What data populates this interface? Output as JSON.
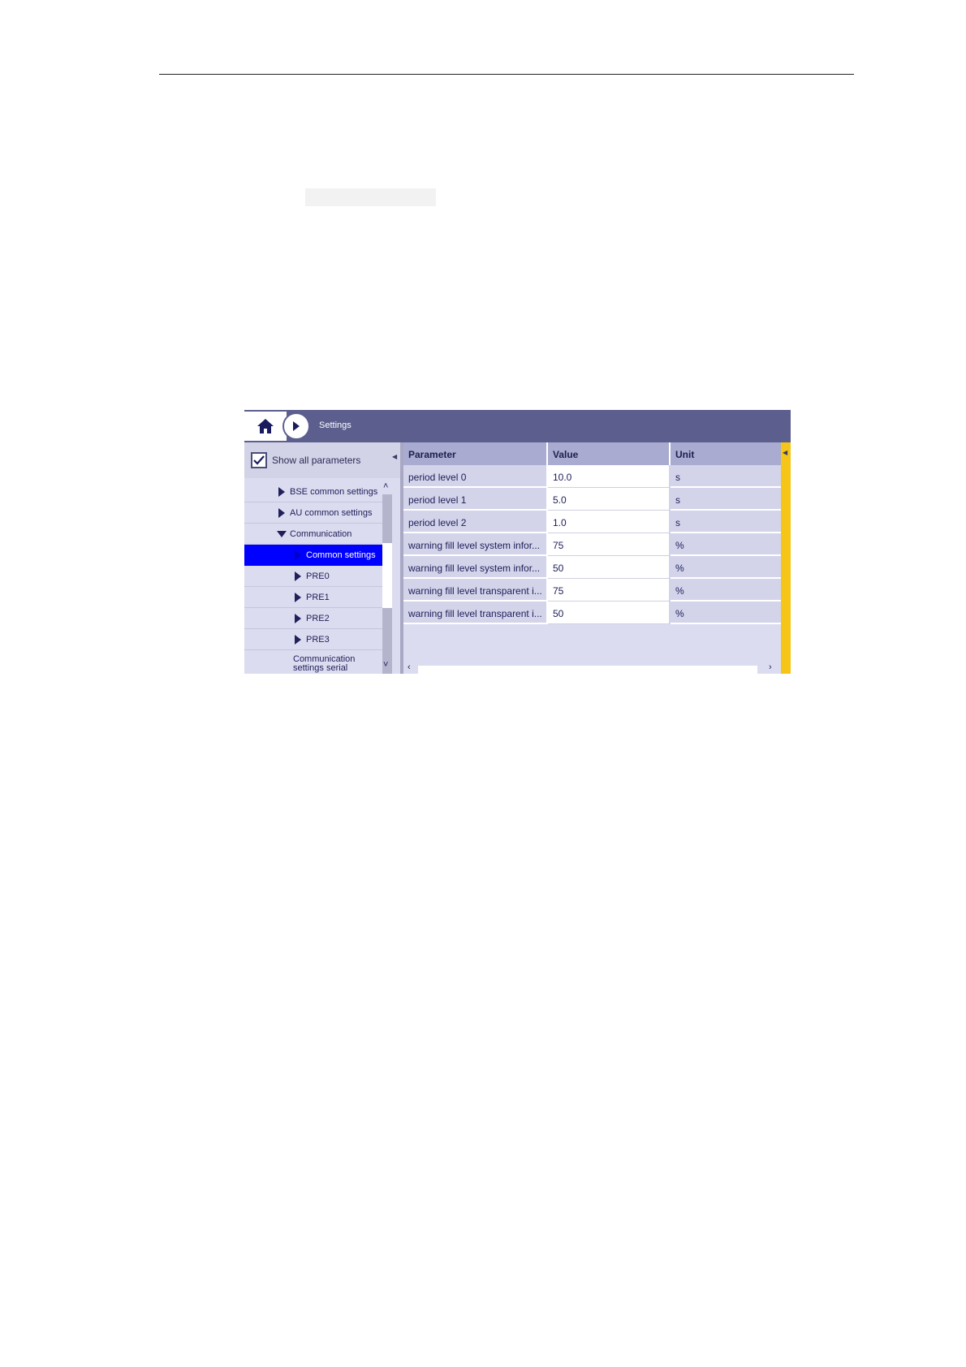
{
  "header": {
    "breadcrumb": "Settings"
  },
  "icons": {
    "home": "home-icon",
    "forward": "forward-icon",
    "check": "check-icon"
  },
  "colors": {
    "topbar": "#5c5f8e",
    "selected": "#0000ff",
    "accent_strip": "#f5c518"
  },
  "left_panel": {
    "show_all_label": "Show all parameters",
    "show_all_checked": true,
    "tree": [
      {
        "label": "BSE common settings",
        "level": 1,
        "expanded": false,
        "selected": false
      },
      {
        "label": "AU common settings",
        "level": 1,
        "expanded": false,
        "selected": false
      },
      {
        "label": "Communication",
        "level": 1,
        "expanded": true,
        "selected": false
      },
      {
        "label": "Common settings",
        "level": 2,
        "expanded": false,
        "selected": true
      },
      {
        "label": "PRE0",
        "level": 2,
        "expanded": false,
        "selected": false
      },
      {
        "label": "PRE1",
        "level": 2,
        "expanded": false,
        "selected": false
      },
      {
        "label": "PRE2",
        "level": 2,
        "expanded": false,
        "selected": false
      },
      {
        "label": "PRE3",
        "level": 2,
        "expanded": false,
        "selected": false
      },
      {
        "label": "Communication settings serial",
        "level": 2,
        "expanded": false,
        "selected": false
      }
    ]
  },
  "table": {
    "columns": [
      "Parameter",
      "Value",
      "Unit"
    ],
    "rows": [
      {
        "parameter": "period level 0",
        "value": "10.0",
        "unit": "s"
      },
      {
        "parameter": "period level 1",
        "value": "5.0",
        "unit": "s"
      },
      {
        "parameter": "period level 2",
        "value": "1.0",
        "unit": "s"
      },
      {
        "parameter": "warning fill level system infor...",
        "value": "75",
        "unit": "%"
      },
      {
        "parameter": "warning fill level system infor...",
        "value": "50",
        "unit": "%"
      },
      {
        "parameter": "warning fill level transparent i...",
        "value": "75",
        "unit": "%"
      },
      {
        "parameter": "warning fill level transparent i...",
        "value": "50",
        "unit": "%"
      }
    ]
  }
}
